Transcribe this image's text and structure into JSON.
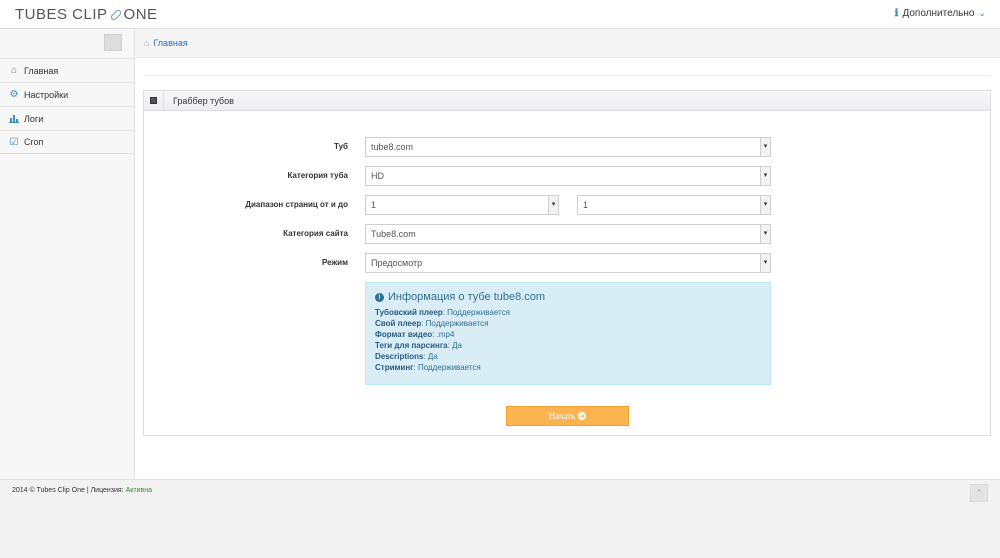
{
  "app": {
    "logo_left": "TUBES CLIP",
    "logo_right": "ONE"
  },
  "header": {
    "more_label": "Дополнительно"
  },
  "sidebar": {
    "items": [
      {
        "label": "Главная",
        "icon": "home-icon"
      },
      {
        "label": "Настройки",
        "icon": "gear-icon"
      },
      {
        "label": "Логи",
        "icon": "bar-chart-icon"
      },
      {
        "label": "Crоп",
        "icon": "checkbox-icon"
      }
    ]
  },
  "breadcrumb": {
    "home_label": "Главная"
  },
  "panel": {
    "title": "Граббер тубов"
  },
  "form": {
    "tube_label": "Туб",
    "tube_value": "tube8.com",
    "category_label": "Категория туба",
    "category_value": "HD",
    "range_label": "Диапазон страниц от и до",
    "range_from": "1",
    "range_to": "1",
    "site_category_label": "Категория сайта",
    "site_category_value": "Tube8.com",
    "mode_label": "Режим",
    "mode_value": "Предосмотр",
    "start_label": "Начать"
  },
  "info": {
    "title": "Информация о тубе tube8.com",
    "rows": [
      {
        "key": "Тубовский плеер",
        "value": "Поддерживается"
      },
      {
        "key": "Свой плеер",
        "value": "Поддерживается"
      },
      {
        "key": "Формат видео",
        "value": ".mp4"
      },
      {
        "key": "Теги для парсинга",
        "value": "Да"
      },
      {
        "key": "Descriptions",
        "value": "Да"
      },
      {
        "key": "Стриминг",
        "value": "Поддерживается"
      }
    ]
  },
  "footer": {
    "text": "2014 © Tubes Clip One | Лицензия:",
    "status": "Активна",
    "status_color": "#2e8b2e"
  },
  "colors": {
    "accent": "#3c8dc5",
    "button": "#fbb450",
    "info_bg": "#d9edf7"
  }
}
